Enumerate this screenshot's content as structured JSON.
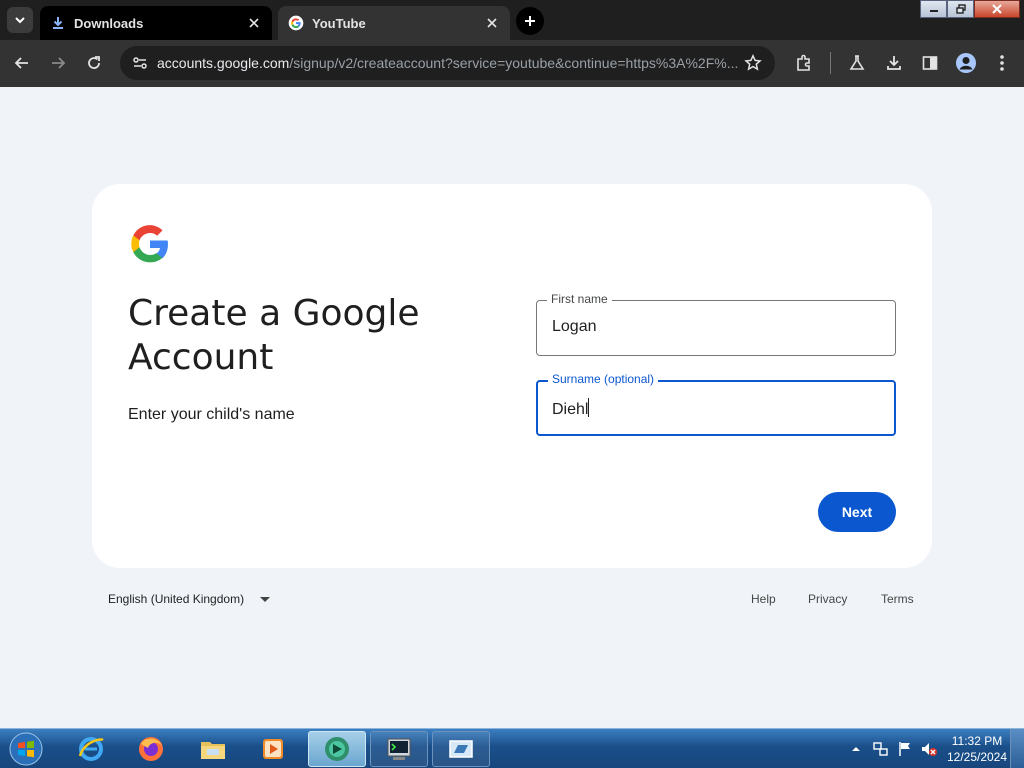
{
  "browser": {
    "tabs": [
      {
        "title": "Downloads",
        "icon": "download-icon",
        "active": false
      },
      {
        "title": "YouTube",
        "icon": "google-g-icon",
        "active": true
      }
    ],
    "url_host": "accounts.google.com",
    "url_path": "/signup/v2/createaccount?service=youtube&continue=https%3A%2F%..."
  },
  "page": {
    "heading": "Create a Google Account",
    "subheading": "Enter your child's name",
    "first_name": {
      "label": "First name",
      "value": "Logan"
    },
    "surname": {
      "label": "Surname (optional)",
      "value": "Diehl"
    },
    "next_label": "Next",
    "brand_colors": {
      "blue": "#4285F4",
      "red": "#EA4335",
      "yellow": "#FBBC05",
      "green": "#34A853",
      "primary": "#0b57d0"
    }
  },
  "footer": {
    "language": "English (United Kingdom)",
    "links": [
      "Help",
      "Privacy",
      "Terms"
    ]
  },
  "taskbar": {
    "apps": [
      "internet-explorer-icon",
      "firefox-icon",
      "file-explorer-icon",
      "media-player-icon",
      "app-green-icon",
      "terminal-icon",
      "app-window-icon"
    ],
    "time": "11:32 PM",
    "date": "12/25/2024"
  }
}
